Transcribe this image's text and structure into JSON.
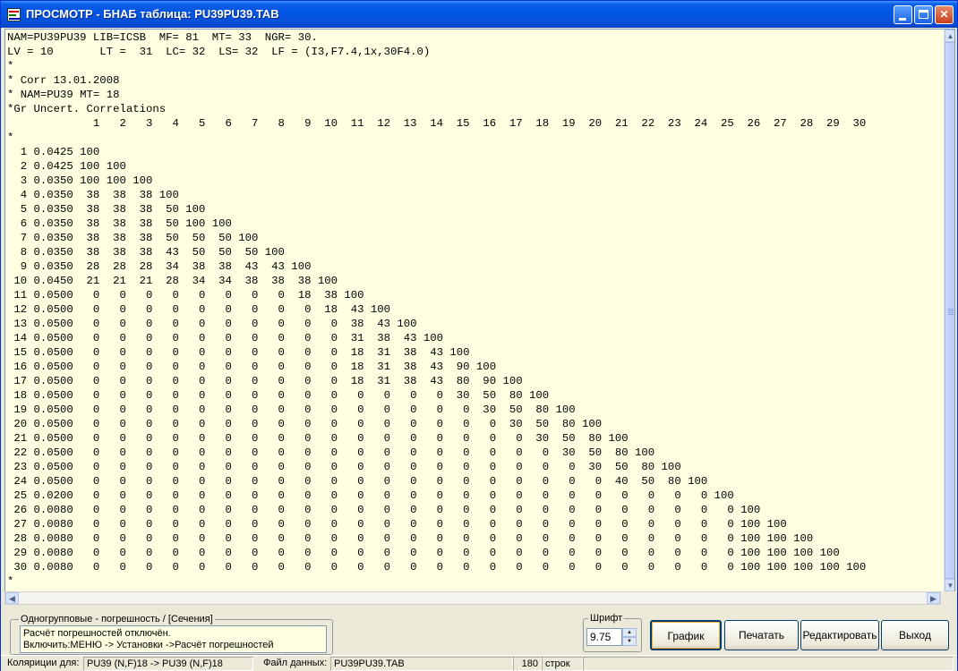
{
  "window": {
    "title": "ПРОСМОТР - БНАБ таблица: PU39PU39.TAB"
  },
  "text_lines": [
    "NAM=PU39PU39 LIB=ICSB  MF= 81  MT= 33  NGR= 30.",
    "LV = 10       LT =  31  LC= 32  LS= 32  LF = (I3,F7.4,1x,30F4.0)",
    "*",
    "* Corr 13.01.2008",
    "* NAM=PU39 MT= 18",
    "*Gr Uncert. Correlations",
    "             1   2   3   4   5   6   7   8   9  10  11  12  13  14  15  16  17  18  19  20  21  22  23  24  25  26  27  28  29  30",
    "*",
    "  1 0.0425 100",
    "  2 0.0425 100 100",
    "  3 0.0350 100 100 100",
    "  4 0.0350  38  38  38 100",
    "  5 0.0350  38  38  38  50 100",
    "  6 0.0350  38  38  38  50 100 100",
    "  7 0.0350  38  38  38  50  50  50 100",
    "  8 0.0350  38  38  38  43  50  50  50 100",
    "  9 0.0350  28  28  28  34  38  38  43  43 100",
    " 10 0.0450  21  21  21  28  34  34  38  38  38 100",
    " 11 0.0500   0   0   0   0   0   0   0   0  18  38 100",
    " 12 0.0500   0   0   0   0   0   0   0   0   0  18  43 100",
    " 13 0.0500   0   0   0   0   0   0   0   0   0   0  38  43 100",
    " 14 0.0500   0   0   0   0   0   0   0   0   0   0  31  38  43 100",
    " 15 0.0500   0   0   0   0   0   0   0   0   0   0  18  31  38  43 100",
    " 16 0.0500   0   0   0   0   0   0   0   0   0   0  18  31  38  43  90 100",
    " 17 0.0500   0   0   0   0   0   0   0   0   0   0  18  31  38  43  80  90 100",
    " 18 0.0500   0   0   0   0   0   0   0   0   0   0   0   0   0   0  30  50  80 100",
    " 19 0.0500   0   0   0   0   0   0   0   0   0   0   0   0   0   0   0  30  50  80 100",
    " 20 0.0500   0   0   0   0   0   0   0   0   0   0   0   0   0   0   0   0  30  50  80 100",
    " 21 0.0500   0   0   0   0   0   0   0   0   0   0   0   0   0   0   0   0   0  30  50  80 100",
    " 22 0.0500   0   0   0   0   0   0   0   0   0   0   0   0   0   0   0   0   0   0  30  50  80 100",
    " 23 0.0500   0   0   0   0   0   0   0   0   0   0   0   0   0   0   0   0   0   0   0  30  50  80 100",
    " 24 0.0500   0   0   0   0   0   0   0   0   0   0   0   0   0   0   0   0   0   0   0   0  40  50  80 100",
    " 25 0.0200   0   0   0   0   0   0   0   0   0   0   0   0   0   0   0   0   0   0   0   0   0   0   0   0 100",
    " 26 0.0080   0   0   0   0   0   0   0   0   0   0   0   0   0   0   0   0   0   0   0   0   0   0   0   0   0 100",
    " 27 0.0080   0   0   0   0   0   0   0   0   0   0   0   0   0   0   0   0   0   0   0   0   0   0   0   0   0 100 100",
    " 28 0.0080   0   0   0   0   0   0   0   0   0   0   0   0   0   0   0   0   0   0   0   0   0   0   0   0   0 100 100 100",
    " 29 0.0080   0   0   0   0   0   0   0   0   0   0   0   0   0   0   0   0   0   0   0   0   0   0   0   0   0 100 100 100 100",
    " 30 0.0080   0   0   0   0   0   0   0   0   0   0   0   0   0   0   0   0   0   0   0   0   0   0   0   0   0 100 100 100 100 100",
    "*"
  ],
  "info_group": {
    "legend": "Одногрупповые - погрешность / [Сечения]",
    "line1": "Расчёт погрешностей отключён.",
    "line2": "Включить:МЕНЮ -> Установки ->Расчёт погрешностей"
  },
  "font": {
    "legend": "Шрифт",
    "value": "9.75"
  },
  "buttons": {
    "graph": "График",
    "print": "Печатать",
    "edit": "Редактировать",
    "exit": "Выход"
  },
  "status": {
    "covariance_label": "Коляриции для:",
    "covariance_value": "PU39 (N,F)18 -> PU39 (N,F)18",
    "file_label": "Файл данных:",
    "file_value": "PU39PU39.TAB",
    "line_count": "180",
    "lines_label": "строк"
  }
}
